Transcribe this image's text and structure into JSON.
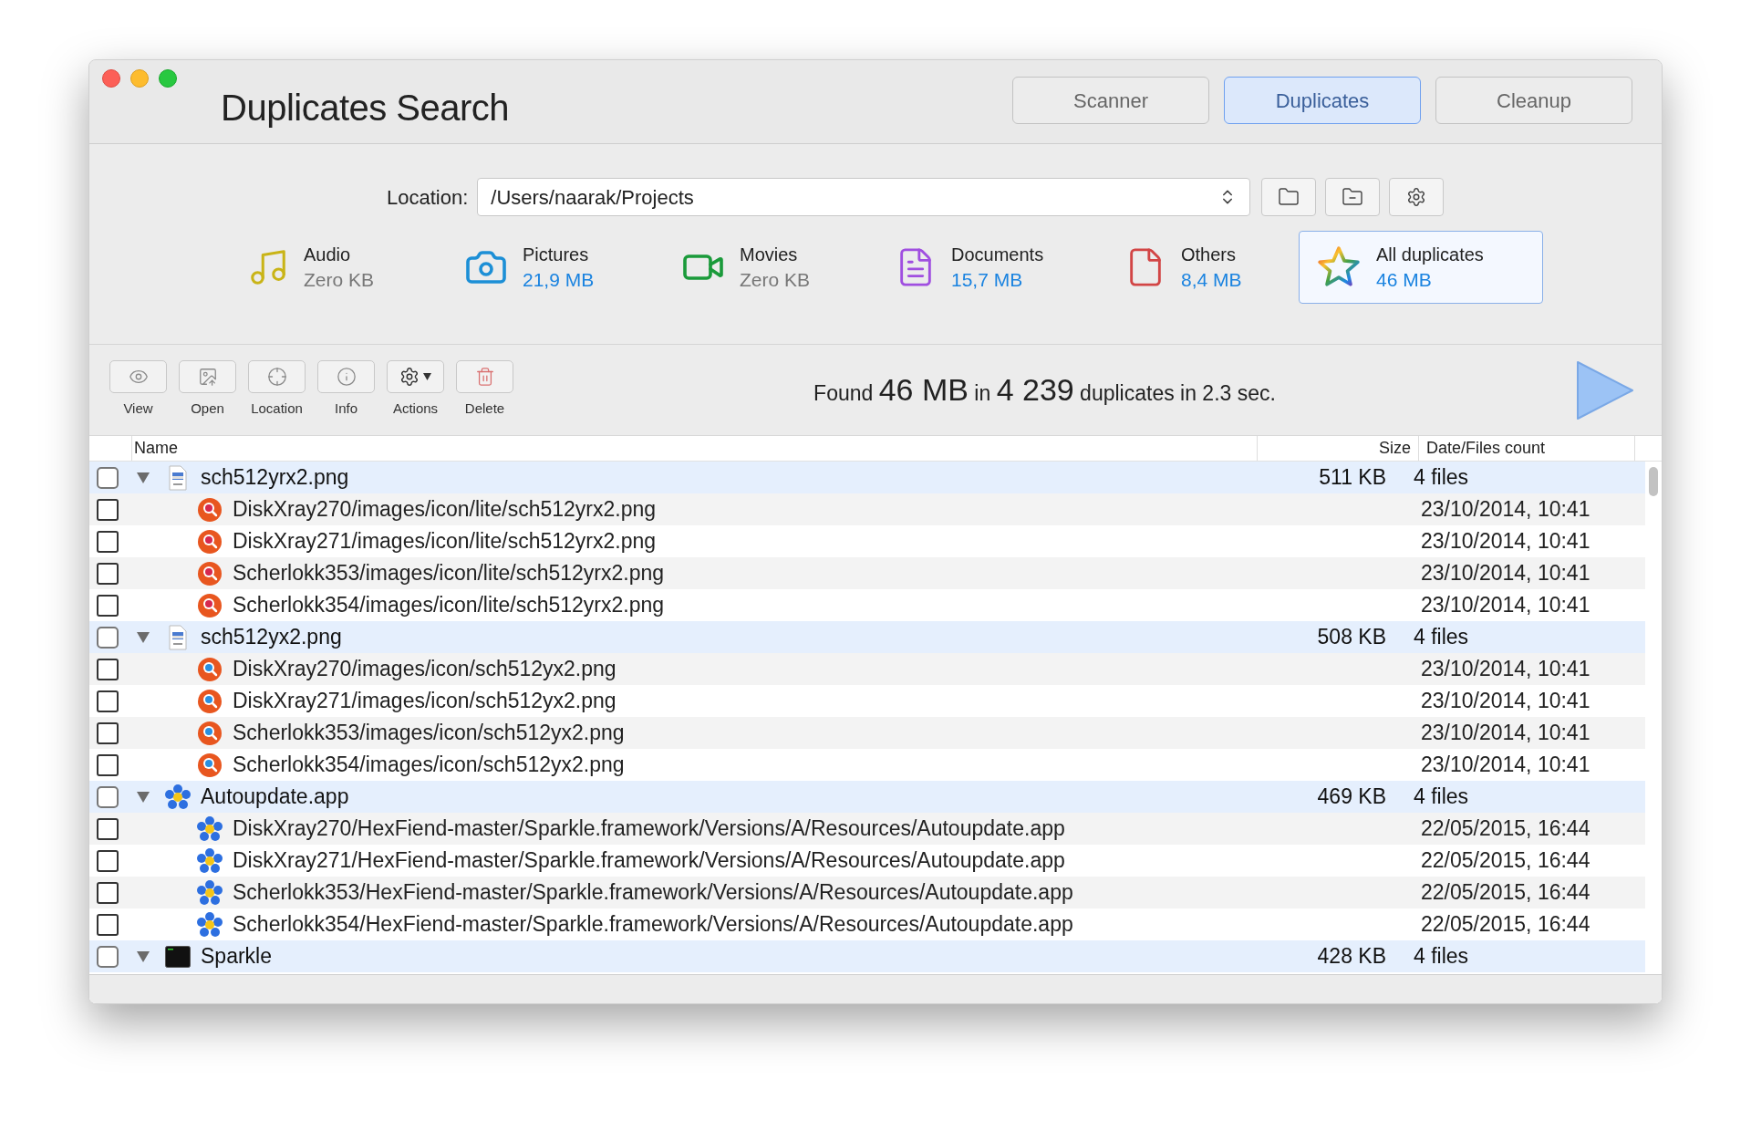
{
  "window": {
    "title": "Duplicates Search"
  },
  "tabs": [
    {
      "label": "Scanner",
      "selected": false
    },
    {
      "label": "Duplicates",
      "selected": true
    },
    {
      "label": "Cleanup",
      "selected": false
    }
  ],
  "location": {
    "label": "Location:",
    "value": "/Users/naarak/Projects"
  },
  "categories": [
    {
      "kind": "audio",
      "name": "Audio",
      "size": "Zero KB",
      "selected": false
    },
    {
      "kind": "pictures",
      "name": "Pictures",
      "size": "21,9 MB",
      "selected": false
    },
    {
      "kind": "movies",
      "name": "Movies",
      "size": "Zero KB",
      "selected": false
    },
    {
      "kind": "documents",
      "name": "Documents",
      "size": "15,7 MB",
      "selected": false
    },
    {
      "kind": "others",
      "name": "Others",
      "size": "8,4 MB",
      "selected": false
    },
    {
      "kind": "all",
      "name": "All duplicates",
      "size": "46 MB",
      "selected": true
    }
  ],
  "toolbar": [
    {
      "kind": "view",
      "label": "View"
    },
    {
      "kind": "open",
      "label": "Open"
    },
    {
      "kind": "location",
      "label": "Location"
    },
    {
      "kind": "info",
      "label": "Info"
    },
    {
      "kind": "actions",
      "label": "Actions"
    },
    {
      "kind": "delete",
      "label": "Delete"
    }
  ],
  "summary": "Found **46 MB** in **4 239** duplicates in 2.3 sec.",
  "table": {
    "columns": [
      "Name",
      "Size",
      "Date/Files count"
    ],
    "groups": [
      {
        "name": "sch512yrx2.png",
        "kind": "png",
        "size": "511 KB",
        "count": "4 files",
        "expanded": true,
        "checked": false,
        "children": [
          {
            "path": "DiskXray270/images/icon/lite/sch512yrx2.png",
            "kind": "search-red",
            "date": "23/10/2014, 10:41",
            "checked": false
          },
          {
            "path": "DiskXray271/images/icon/lite/sch512yrx2.png",
            "kind": "search-red",
            "date": "23/10/2014, 10:41",
            "checked": false
          },
          {
            "path": "Scherlokk353/images/icon/lite/sch512yrx2.png",
            "kind": "search-red",
            "date": "23/10/2014, 10:41",
            "checked": false
          },
          {
            "path": "Scherlokk354/images/icon/lite/sch512yrx2.png",
            "kind": "search-red",
            "date": "23/10/2014, 10:41",
            "checked": false
          }
        ]
      },
      {
        "name": "sch512yx2.png",
        "kind": "png",
        "size": "508 KB",
        "count": "4 files",
        "expanded": true,
        "checked": false,
        "children": [
          {
            "path": "DiskXray270/images/icon/sch512yx2.png",
            "kind": "search-blue",
            "date": "23/10/2014, 10:41",
            "checked": false
          },
          {
            "path": "DiskXray271/images/icon/sch512yx2.png",
            "kind": "search-blue",
            "date": "23/10/2014, 10:41",
            "checked": false
          },
          {
            "path": "Scherlokk353/images/icon/sch512yx2.png",
            "kind": "search-blue",
            "date": "23/10/2014, 10:41",
            "checked": false
          },
          {
            "path": "Scherlokk354/images/icon/sch512yx2.png",
            "kind": "search-blue",
            "date": "23/10/2014, 10:41",
            "checked": false
          }
        ]
      },
      {
        "name": "Autoupdate.app",
        "kind": "app",
        "size": "469 KB",
        "count": "4 files",
        "expanded": true,
        "checked": false,
        "children": [
          {
            "path": "DiskXray270/HexFiend-master/Sparkle.framework/Versions/A/Resources/Autoupdate.app",
            "kind": "app",
            "date": "22/05/2015, 16:44",
            "checked": false
          },
          {
            "path": "DiskXray271/HexFiend-master/Sparkle.framework/Versions/A/Resources/Autoupdate.app",
            "kind": "app",
            "date": "22/05/2015, 16:44",
            "checked": false
          },
          {
            "path": "Scherlokk353/HexFiend-master/Sparkle.framework/Versions/A/Resources/Autoupdate.app",
            "kind": "app",
            "date": "22/05/2015, 16:44",
            "checked": false
          },
          {
            "path": "Scherlokk354/HexFiend-master/Sparkle.framework/Versions/A/Resources/Autoupdate.app",
            "kind": "app",
            "date": "22/05/2015, 16:44",
            "checked": false
          }
        ]
      },
      {
        "name": "Sparkle",
        "kind": "terminal",
        "size": "428 KB",
        "count": "4 files",
        "expanded": true,
        "checked": false
      }
    ]
  }
}
